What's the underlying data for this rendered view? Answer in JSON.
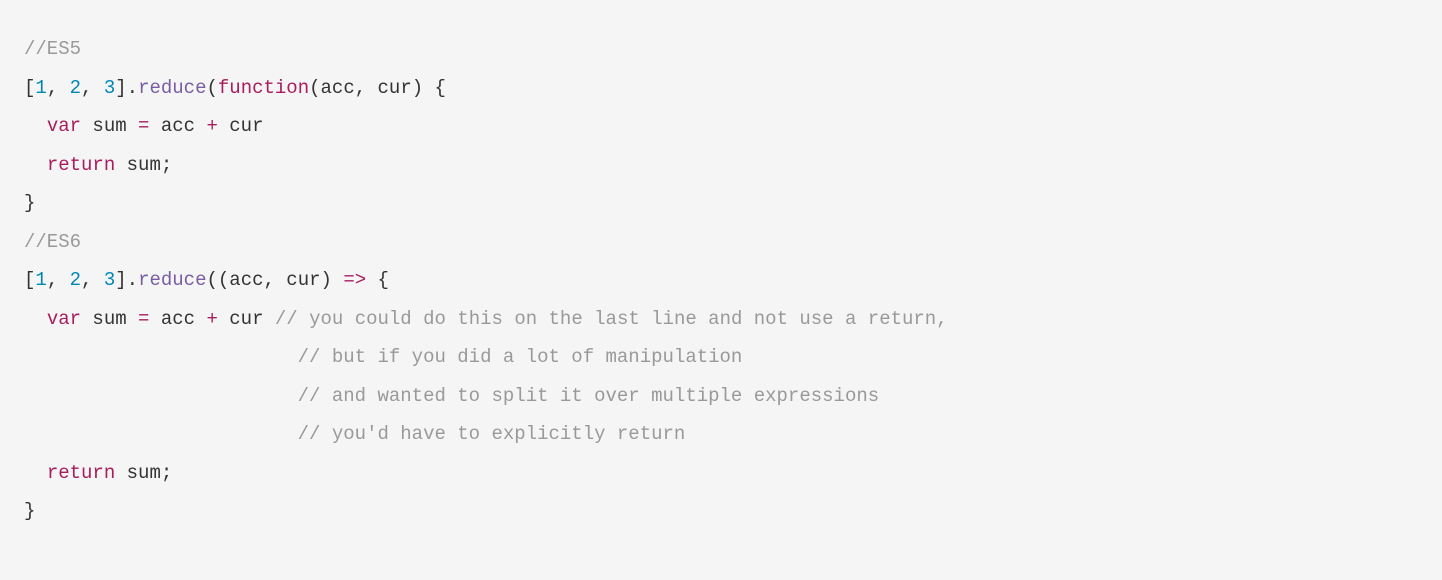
{
  "code": {
    "lines": [
      [
        {
          "cls": "c",
          "t": "//ES5"
        }
      ],
      [
        {
          "cls": "p",
          "t": "["
        },
        {
          "cls": "n",
          "t": "1"
        },
        {
          "cls": "p",
          "t": ", "
        },
        {
          "cls": "n",
          "t": "2"
        },
        {
          "cls": "p",
          "t": ", "
        },
        {
          "cls": "n",
          "t": "3"
        },
        {
          "cls": "p",
          "t": "]."
        },
        {
          "cls": "fn",
          "t": "reduce"
        },
        {
          "cls": "p",
          "t": "("
        },
        {
          "cls": "k",
          "t": "function"
        },
        {
          "cls": "p",
          "t": "(acc, cur) {"
        }
      ],
      [
        {
          "cls": "p",
          "t": "  "
        },
        {
          "cls": "k",
          "t": "var"
        },
        {
          "cls": "p",
          "t": " sum "
        },
        {
          "cls": "k",
          "t": "="
        },
        {
          "cls": "p",
          "t": " acc "
        },
        {
          "cls": "k",
          "t": "+"
        },
        {
          "cls": "p",
          "t": " cur"
        }
      ],
      [
        {
          "cls": "p",
          "t": "  "
        },
        {
          "cls": "k",
          "t": "return"
        },
        {
          "cls": "p",
          "t": " sum;"
        }
      ],
      [
        {
          "cls": "p",
          "t": "}"
        }
      ],
      [
        {
          "cls": "c",
          "t": "//ES6"
        }
      ],
      [
        {
          "cls": "p",
          "t": "["
        },
        {
          "cls": "n",
          "t": "1"
        },
        {
          "cls": "p",
          "t": ", "
        },
        {
          "cls": "n",
          "t": "2"
        },
        {
          "cls": "p",
          "t": ", "
        },
        {
          "cls": "n",
          "t": "3"
        },
        {
          "cls": "p",
          "t": "]."
        },
        {
          "cls": "fn",
          "t": "reduce"
        },
        {
          "cls": "p",
          "t": "((acc, cur) "
        },
        {
          "cls": "k",
          "t": "=>"
        },
        {
          "cls": "p",
          "t": " {"
        }
      ],
      [
        {
          "cls": "p",
          "t": "  "
        },
        {
          "cls": "k",
          "t": "var"
        },
        {
          "cls": "p",
          "t": " sum "
        },
        {
          "cls": "k",
          "t": "="
        },
        {
          "cls": "p",
          "t": " acc "
        },
        {
          "cls": "k",
          "t": "+"
        },
        {
          "cls": "p",
          "t": " cur "
        },
        {
          "cls": "c",
          "t": "// you could do this on the last line and not use a return,"
        }
      ],
      [
        {
          "cls": "p",
          "t": "                        "
        },
        {
          "cls": "c",
          "t": "// but if you did a lot of manipulation"
        }
      ],
      [
        {
          "cls": "p",
          "t": "                        "
        },
        {
          "cls": "c",
          "t": "// and wanted to split it over multiple expressions"
        }
      ],
      [
        {
          "cls": "p",
          "t": "                        "
        },
        {
          "cls": "c",
          "t": "// you'd have to explicitly return"
        }
      ],
      [
        {
          "cls": "p",
          "t": "  "
        },
        {
          "cls": "k",
          "t": "return"
        },
        {
          "cls": "p",
          "t": " sum;"
        }
      ],
      [
        {
          "cls": "p",
          "t": "}"
        }
      ]
    ]
  }
}
